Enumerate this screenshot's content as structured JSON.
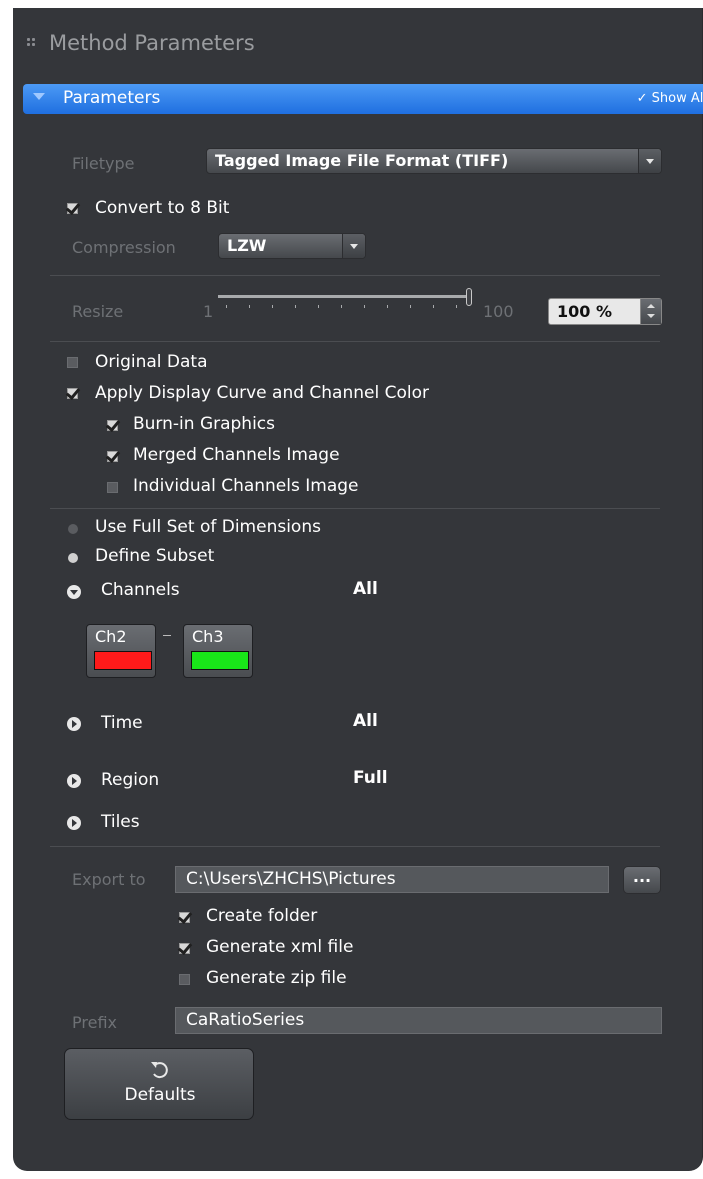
{
  "panel": {
    "title": "Method Parameters"
  },
  "section": {
    "title": "Parameters",
    "show_all_label": "✓ Show All"
  },
  "filetype": {
    "label": "Filetype",
    "value": "Tagged Image File Format (TIFF)"
  },
  "convert_8bit": {
    "label": "Convert to 8 Bit",
    "checked": true
  },
  "compression": {
    "label": "Compression",
    "value": "LZW"
  },
  "resize": {
    "label": "Resize",
    "min": "1",
    "max": "100",
    "value": "100 %",
    "slider_fraction": 1.0
  },
  "original_data": {
    "label": "Original Data",
    "checked": false
  },
  "apply_display": {
    "label": "Apply Display Curve and Channel Color",
    "checked": true
  },
  "burn_in": {
    "label": "Burn-in Graphics",
    "checked": true
  },
  "merged_channels": {
    "label": "Merged Channels Image",
    "checked": true
  },
  "individual_channels": {
    "label": "Individual Channels Image",
    "checked": false
  },
  "full_set": {
    "label": "Use Full Set of Dimensions",
    "selected": false
  },
  "define_subset": {
    "label": "Define Subset",
    "selected": true
  },
  "channels": {
    "label": "Channels",
    "value": "All",
    "items": [
      {
        "label": "Ch2",
        "color": "#ff1a1a"
      },
      {
        "label": "Ch3",
        "color": "#19e619"
      }
    ]
  },
  "time": {
    "label": "Time",
    "value": "All"
  },
  "region": {
    "label": "Region",
    "value": "Full"
  },
  "tiles": {
    "label": "Tiles"
  },
  "export": {
    "label": "Export to",
    "path": "C:\\Users\\ZHCHS\\Pictures",
    "browse_label": "..."
  },
  "create_folder": {
    "label": "Create folder",
    "checked": true
  },
  "generate_xml": {
    "label": "Generate xml file",
    "checked": true
  },
  "generate_zip": {
    "label": "Generate zip file",
    "checked": false
  },
  "prefix": {
    "label": "Prefix",
    "value": "CaRatioSeries"
  },
  "defaults_button": {
    "label": "Defaults",
    "icon": "undo-icon"
  },
  "colors": {
    "accent": "#2d7fec",
    "panel_bg": "#34363a"
  }
}
